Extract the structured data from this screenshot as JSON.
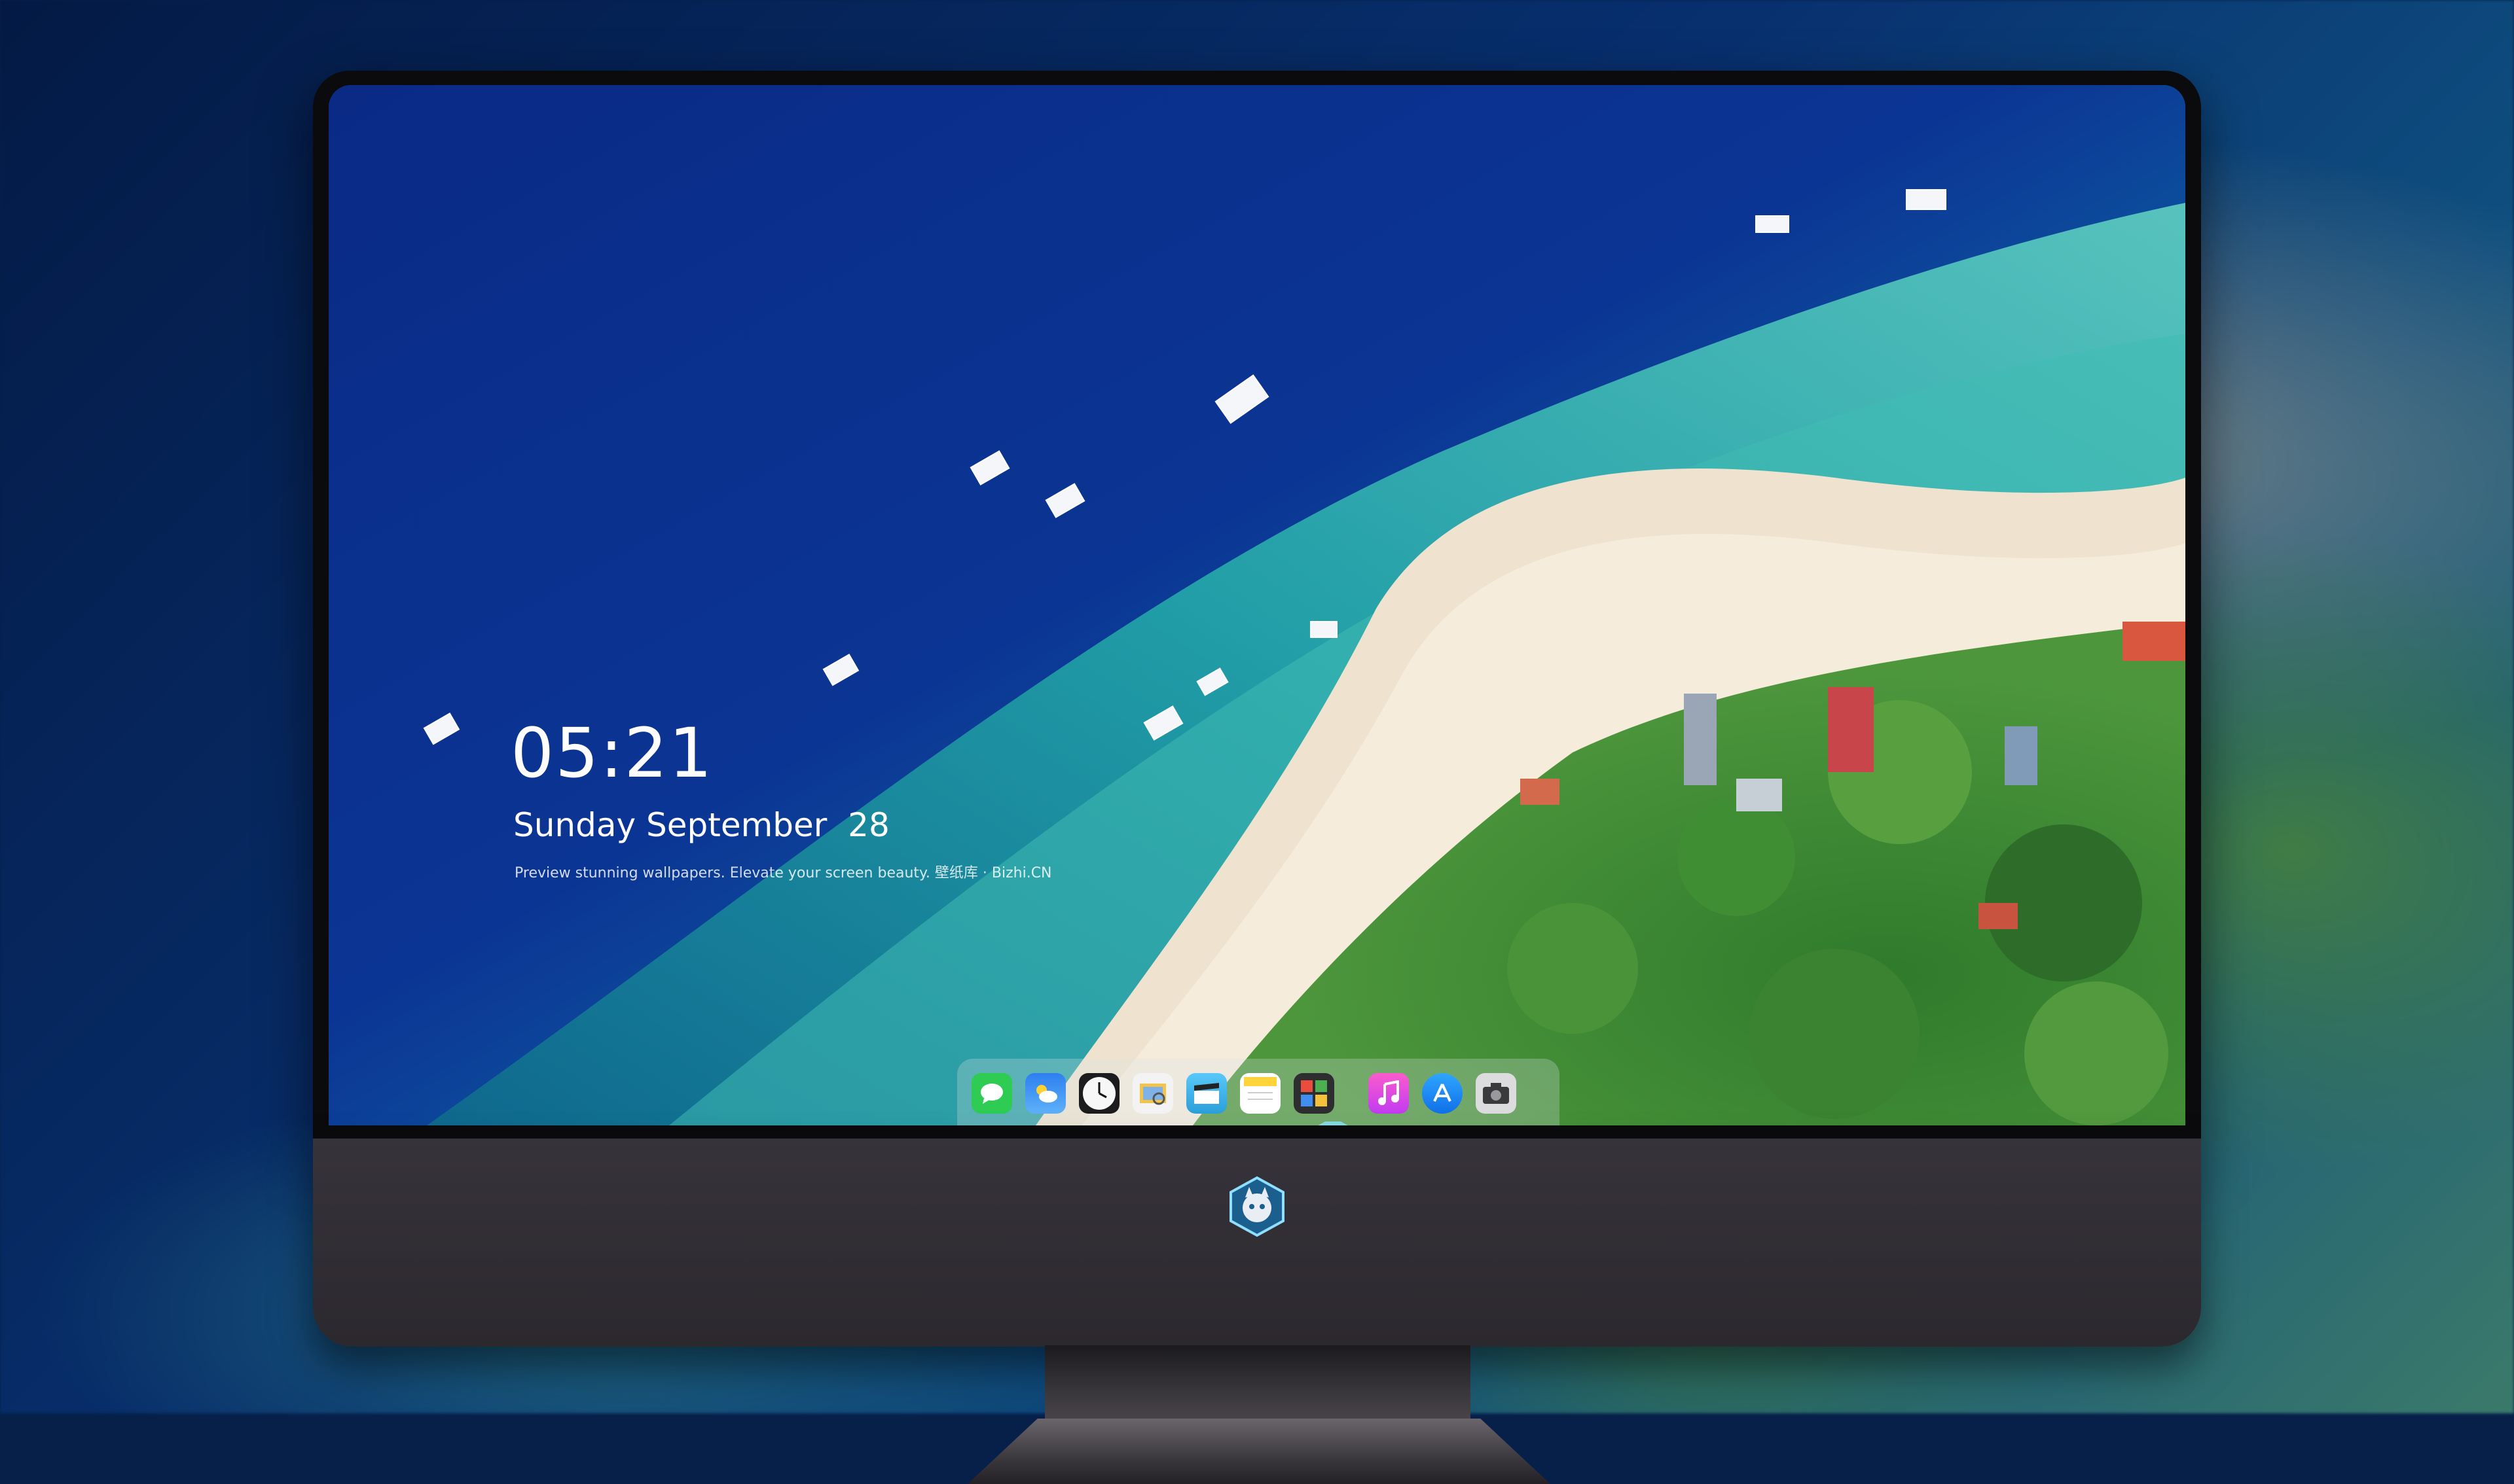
{
  "lockscreen": {
    "time": "05:21",
    "date": "Sunday September  28",
    "tagline": "Preview stunning wallpapers. Elevate your screen beauty. 壁纸库 · Bizhi.CN"
  },
  "dock": {
    "apps": [
      {
        "name": "messages-icon",
        "color": "#2ecc52"
      },
      {
        "name": "weather-icon",
        "color": "#3b8ef0"
      },
      {
        "name": "clock-icon",
        "color": "#f4f4f4"
      },
      {
        "name": "preview-icon",
        "color": "#f3c34a"
      },
      {
        "name": "clips-icon",
        "color": "#5ac8fa"
      },
      {
        "name": "notes-icon",
        "color": "#ffd43b"
      },
      {
        "name": "photo-booth-icon",
        "color": "#e94e3c"
      },
      {
        "name": "music-icon",
        "color": "#f05ad8"
      },
      {
        "name": "app-store-icon",
        "color": "#1a8cf6"
      },
      {
        "name": "camera-icon",
        "color": "#8e8e93"
      }
    ]
  }
}
